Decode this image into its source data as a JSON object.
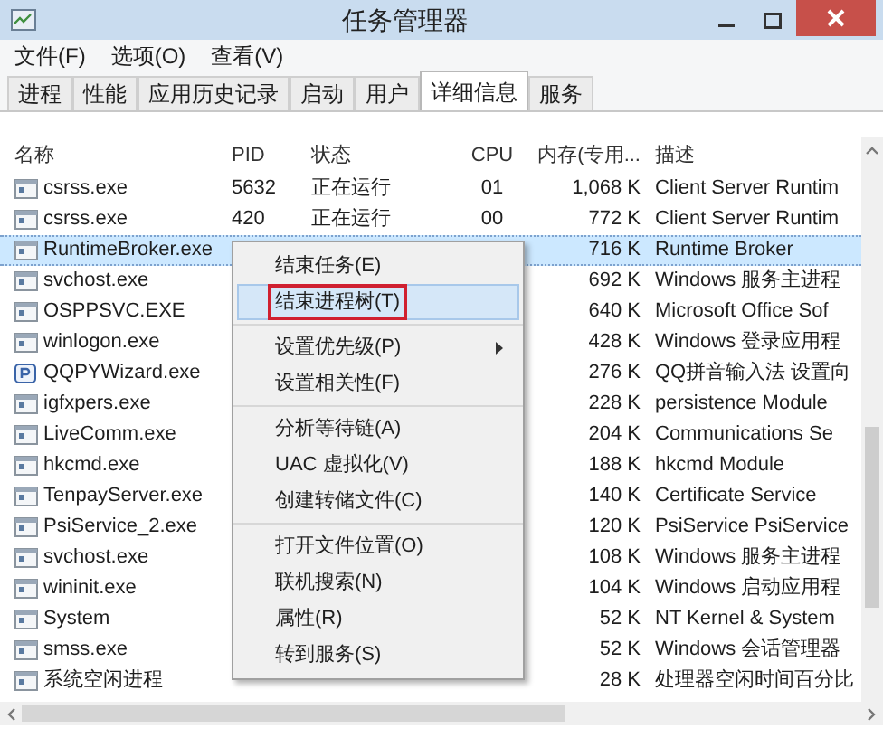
{
  "window": {
    "title": "任务管理器"
  },
  "menu_bar": [
    "文件(F)",
    "选项(O)",
    "查看(V)"
  ],
  "tabs": [
    {
      "label": "进程",
      "selected": false
    },
    {
      "label": "性能",
      "selected": false
    },
    {
      "label": "应用历史记录",
      "selected": false
    },
    {
      "label": "启动",
      "selected": false
    },
    {
      "label": "用户",
      "selected": false
    },
    {
      "label": "详细信息",
      "selected": true
    },
    {
      "label": "服务",
      "selected": false
    }
  ],
  "table": {
    "columns": [
      "名称",
      "PID",
      "状态",
      "CPU",
      "内存(专用...",
      "描述"
    ],
    "rows": [
      {
        "name": "csrss.exe",
        "pid": "5632",
        "status": "正在运行",
        "cpu": "01",
        "memory": "1,068 K",
        "description": "Client Server Runtim",
        "kind": "window",
        "selected": false
      },
      {
        "name": "csrss.exe",
        "pid": "420",
        "status": "正在运行",
        "cpu": "00",
        "memory": "772 K",
        "description": "Client Server Runtim",
        "kind": "window",
        "selected": false
      },
      {
        "name": "RuntimeBroker.exe",
        "memory": "716 K",
        "description": "Runtime Broker",
        "kind": "window",
        "selected": true
      },
      {
        "name": "svchost.exe",
        "memory": "692 K",
        "description": "Windows 服务主进程",
        "kind": "window",
        "selected": false
      },
      {
        "name": "OSPPSVC.EXE",
        "memory": "640 K",
        "description": "Microsoft Office Sof",
        "kind": "window",
        "selected": false
      },
      {
        "name": "winlogon.exe",
        "memory": "428 K",
        "description": "Windows 登录应用程",
        "kind": "window",
        "selected": false
      },
      {
        "name": "QQPYWizard.exe",
        "memory": "276 K",
        "description": "QQ拼音输入法 设置向",
        "kind": "badge",
        "selected": false
      },
      {
        "name": "igfxpers.exe",
        "memory": "228 K",
        "description": "persistence Module",
        "kind": "window",
        "selected": false
      },
      {
        "name": "LiveComm.exe",
        "memory": "204 K",
        "description": "Communications Se",
        "kind": "window",
        "selected": false
      },
      {
        "name": "hkcmd.exe",
        "memory": "188 K",
        "description": "hkcmd Module",
        "kind": "window",
        "selected": false
      },
      {
        "name": "TenpayServer.exe",
        "memory": "140 K",
        "description": "Certificate Service",
        "kind": "window",
        "selected": false
      },
      {
        "name": "PsiService_2.exe",
        "memory": "120 K",
        "description": "PsiService PsiService",
        "kind": "window",
        "selected": false
      },
      {
        "name": "svchost.exe",
        "memory": "108 K",
        "description": "Windows 服务主进程",
        "kind": "window",
        "selected": false
      },
      {
        "name": "wininit.exe",
        "memory": "104 K",
        "description": "Windows 启动应用程",
        "kind": "window",
        "selected": false
      },
      {
        "name": "System",
        "memory": "52 K",
        "description": "NT Kernel & System",
        "kind": "window",
        "selected": false
      },
      {
        "name": "smss.exe",
        "memory": "52 K",
        "description": "Windows 会话管理器",
        "kind": "window",
        "selected": false
      },
      {
        "name": "系统空闲进程",
        "memory": "28 K",
        "description": "处理器空闲时间百分比",
        "kind": "window",
        "selected": false
      }
    ]
  },
  "context_menu": {
    "groups": [
      [
        {
          "label": "结束任务(E)",
          "selected": false,
          "marked": false,
          "submenu": false
        },
        {
          "label": "结束进程树(T)",
          "selected": true,
          "marked": true,
          "submenu": false
        }
      ],
      [
        {
          "label": "设置优先级(P)",
          "selected": false,
          "marked": false,
          "submenu": true
        },
        {
          "label": "设置相关性(F)",
          "selected": false,
          "marked": false,
          "submenu": false
        }
      ],
      [
        {
          "label": "分析等待链(A)",
          "selected": false,
          "marked": false,
          "submenu": false
        },
        {
          "label": "UAC 虚拟化(V)",
          "selected": false,
          "marked": false,
          "submenu": false
        },
        {
          "label": "创建转储文件(C)",
          "selected": false,
          "marked": false,
          "submenu": false
        }
      ],
      [
        {
          "label": "打开文件位置(O)",
          "selected": false,
          "marked": false,
          "submenu": false
        },
        {
          "label": "联机搜索(N)",
          "selected": false,
          "marked": false,
          "submenu": false
        },
        {
          "label": "属性(R)",
          "selected": false,
          "marked": false,
          "submenu": false
        },
        {
          "label": "转到服务(S)",
          "selected": false,
          "marked": false,
          "submenu": false
        }
      ]
    ]
  }
}
